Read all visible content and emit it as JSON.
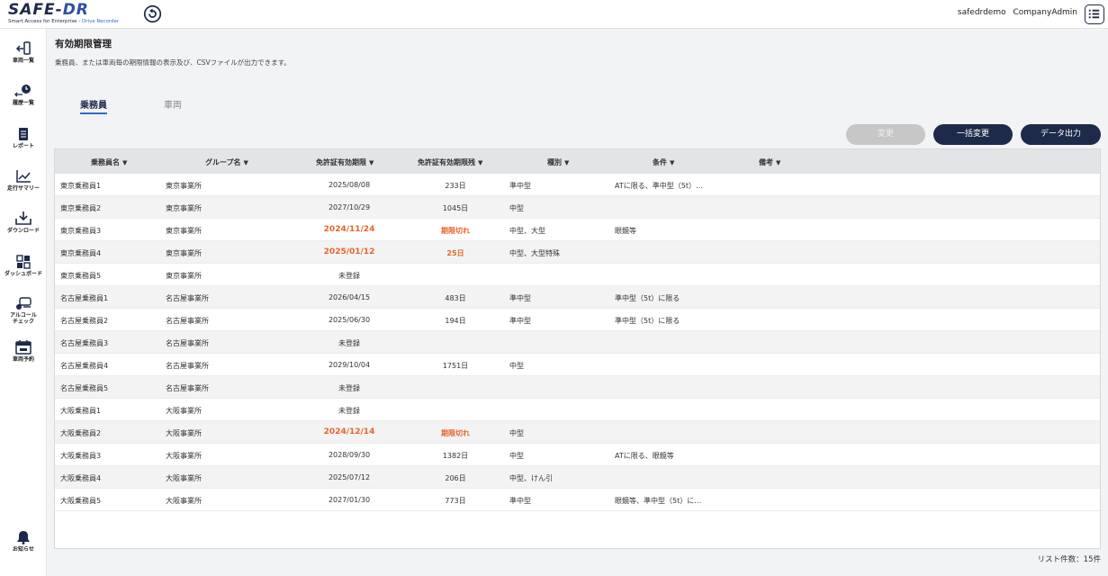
{
  "header": {
    "logo_main": "SAFE-",
    "logo_dr": "DR",
    "logo_sub_1": "Smart Access for Enterprise - ",
    "logo_sub_2": "Drive Recorder",
    "username": "safedrdemo",
    "role": "CompanyAdmin"
  },
  "sidebar": {
    "items": [
      {
        "label": "車両一覧",
        "icon": "vehicle-list-icon"
      },
      {
        "label": "履歴一覧",
        "icon": "history-icon"
      },
      {
        "label": "レポート",
        "icon": "report-icon"
      },
      {
        "label": "走行サマリー",
        "icon": "chart-icon"
      },
      {
        "label": "ダウンロード",
        "icon": "download-icon"
      },
      {
        "label": "ダッシュボード",
        "icon": "dashboard-icon"
      },
      {
        "label": "アルコール",
        "label2": "チェック",
        "icon": "alcohol-check-icon"
      },
      {
        "label": "車両予約",
        "icon": "calendar-icon"
      },
      {
        "label": "お知らせ",
        "icon": "bell-icon"
      }
    ]
  },
  "page": {
    "title": "有効期限管理",
    "description": "乗務員、または車両毎の期限情報の表示及び、CSVファイルが出力できます。"
  },
  "tabs": [
    {
      "label": "乗務員",
      "active": true
    },
    {
      "label": "車両",
      "active": false
    }
  ],
  "buttons": {
    "change": "変更",
    "bulk_change": "一括変更",
    "export": "データ出力"
  },
  "table": {
    "headers": [
      "乗務員名",
      "グループ名",
      "免許証有効期限",
      "免許証有効期限残",
      "種別",
      "条件",
      "備考"
    ],
    "rows": [
      {
        "name": "東京乗務員1",
        "group": "東京事業所",
        "expiry": "2025/08/08",
        "remaining": "233日",
        "type": "準中型",
        "condition": "ATに限る、準中型（5t）…",
        "note": "",
        "warn": false
      },
      {
        "name": "東京乗務員2",
        "group": "東京事業所",
        "expiry": "2027/10/29",
        "remaining": "1045日",
        "type": "中型",
        "condition": "",
        "note": "",
        "warn": false
      },
      {
        "name": "東京乗務員3",
        "group": "東京事業所",
        "expiry": "2024/11/24",
        "remaining": "期限切れ",
        "type": "中型、大型",
        "condition": "眼鏡等",
        "note": "",
        "warn": true
      },
      {
        "name": "東京乗務員4",
        "group": "東京事業所",
        "expiry": "2025/01/12",
        "remaining": "25日",
        "type": "中型、大型特殊",
        "condition": "",
        "note": "",
        "warn": true
      },
      {
        "name": "東京乗務員5",
        "group": "東京事業所",
        "expiry": "未登録",
        "remaining": "",
        "type": "",
        "condition": "",
        "note": "",
        "warn": false
      },
      {
        "name": "名古屋乗務員1",
        "group": "名古屋事業所",
        "expiry": "2026/04/15",
        "remaining": "483日",
        "type": "準中型",
        "condition": "準中型（5t）に限る",
        "note": "",
        "warn": false
      },
      {
        "name": "名古屋乗務員2",
        "group": "名古屋事業所",
        "expiry": "2025/06/30",
        "remaining": "194日",
        "type": "準中型",
        "condition": "準中型（5t）に限る",
        "note": "",
        "warn": false
      },
      {
        "name": "名古屋乗務員3",
        "group": "名古屋事業所",
        "expiry": "未登録",
        "remaining": "",
        "type": "",
        "condition": "",
        "note": "",
        "warn": false
      },
      {
        "name": "名古屋乗務員4",
        "group": "名古屋事業所",
        "expiry": "2029/10/04",
        "remaining": "1751日",
        "type": "中型",
        "condition": "",
        "note": "",
        "warn": false
      },
      {
        "name": "名古屋乗務員5",
        "group": "名古屋事業所",
        "expiry": "未登録",
        "remaining": "",
        "type": "",
        "condition": "",
        "note": "",
        "warn": false
      },
      {
        "name": "大阪乗務員1",
        "group": "大阪事業所",
        "expiry": "未登録",
        "remaining": "",
        "type": "",
        "condition": "",
        "note": "",
        "warn": false
      },
      {
        "name": "大阪乗務員2",
        "group": "大阪事業所",
        "expiry": "2024/12/14",
        "remaining": "期限切れ",
        "type": "中型",
        "condition": "",
        "note": "",
        "warn": true
      },
      {
        "name": "大阪乗務員3",
        "group": "大阪事業所",
        "expiry": "2028/09/30",
        "remaining": "1382日",
        "type": "中型",
        "condition": "ATに限る、眼鏡等",
        "note": "",
        "warn": false
      },
      {
        "name": "大阪乗務員4",
        "group": "大阪事業所",
        "expiry": "2025/07/12",
        "remaining": "206日",
        "type": "中型、けん引",
        "condition": "",
        "note": "",
        "warn": false
      },
      {
        "name": "大阪乗務員5",
        "group": "大阪事業所",
        "expiry": "2027/01/30",
        "remaining": "773日",
        "type": "準中型",
        "condition": "眼鏡等、準中型（5t）に…",
        "note": "",
        "warn": false
      }
    ]
  },
  "footer": {
    "list_count": "リスト件数：15件"
  },
  "colors": {
    "navy": "#1e2a4a",
    "accent": "#2d6bd0",
    "warning": "#e8642b",
    "disabled": "#c7c7c7"
  }
}
